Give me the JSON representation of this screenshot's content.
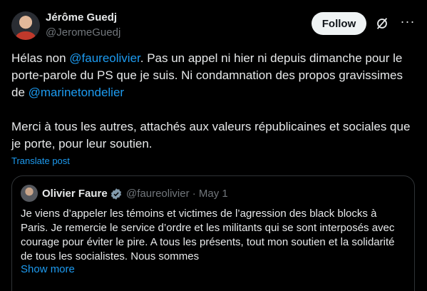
{
  "author": {
    "name": "Jérôme Guedj",
    "handle": "@JeromeGuedj",
    "follow_label": "Follow"
  },
  "post": {
    "line1_before": "Hélas non ",
    "mention1": "@faureolivier",
    "line1_after": ". Pas un appel ni hier ni depuis dimanche pour le porte-parole du PS que je suis. Ni condamnation des propos gravissimes de ",
    "mention2": "@marinetondelier",
    "paragraph2": "Merci à tous les autres, attachés aux valeurs républicaines et sociales que je porte, pour leur soutien.",
    "translate_label": "Translate post"
  },
  "quoted": {
    "name": "Olivier Faure",
    "meta": "@faureolivier · May 1",
    "text": "Je viens d’appeler les témoins et victimes de l’agression des black blocks à Paris. Je remercie le service d’ordre et les militants qui se sont interposés avec courage pour éviter le pire. A tous les présents, tout mon soutien et la solidarité de tous les socialistes. Nous sommes",
    "show_more": "Show more"
  },
  "colors": {
    "background": "#000000",
    "link": "#1d9bf0",
    "muted": "#71767b",
    "text": "#e7e9ea"
  },
  "icons": [
    "grok-icon",
    "more-icon",
    "verified-icon"
  ]
}
